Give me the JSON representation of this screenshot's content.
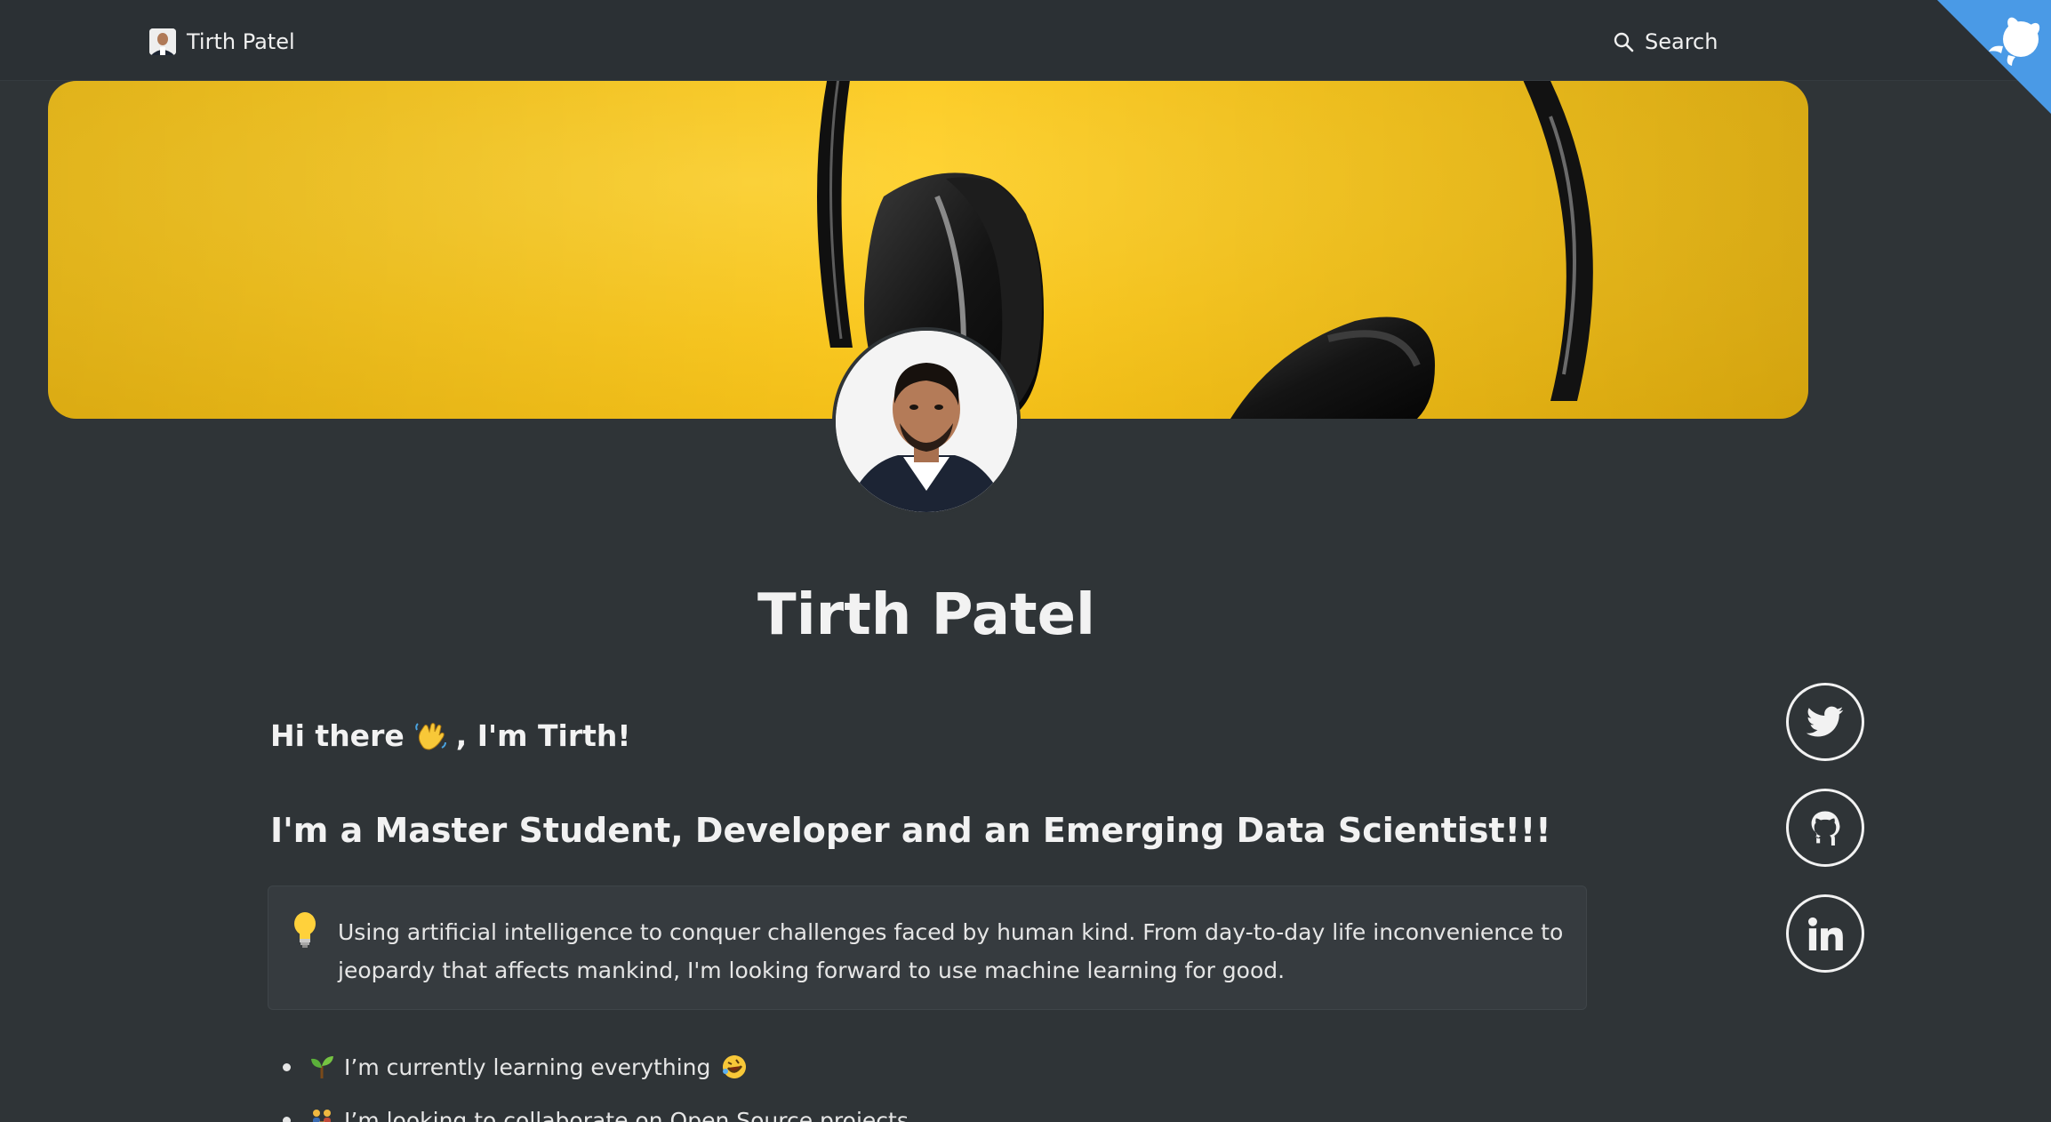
{
  "nav": {
    "brand_name": "Tirth Patel",
    "search_label": "Search",
    "avatar_icon": "profile-avatar",
    "search_icon": "search-icon",
    "corner_icon": "octocat-icon"
  },
  "profile": {
    "name": "Tirth Patel",
    "cover_icon": "headphones-cover-image"
  },
  "intro": {
    "greeting_prefix": "Hi there",
    "greeting_emoji": "waving-hand",
    "greeting_suffix": ", I'm Tirth!",
    "role": "I'm a Master Student, Developer and an Emerging Data Scientist!!!"
  },
  "callout": {
    "icon": "lightbulb-icon",
    "text": "Using artificial intelligence to conquer challenges faced by human kind. From day-to-day life inconvenience to jeopardy that affects mankind, I'm looking forward to use machine learning for good."
  },
  "bullets": [
    {
      "icon": "seedling-icon",
      "text": "I’m currently learning everything",
      "trailing_icon": "rofl-face-icon"
    },
    {
      "icon": "people-holding-hands-icon",
      "text": "I’m looking to collaborate on Open Source projects"
    }
  ],
  "social": [
    {
      "name": "twitter",
      "icon": "twitter-icon"
    },
    {
      "name": "github",
      "icon": "github-icon"
    },
    {
      "name": "linkedin",
      "icon": "linkedin-icon"
    }
  ],
  "colors": {
    "background": "#2f3437",
    "cover_yellow": "#fbc921",
    "corner_blue": "#4a9ae6",
    "text": "#f2f2f2"
  }
}
